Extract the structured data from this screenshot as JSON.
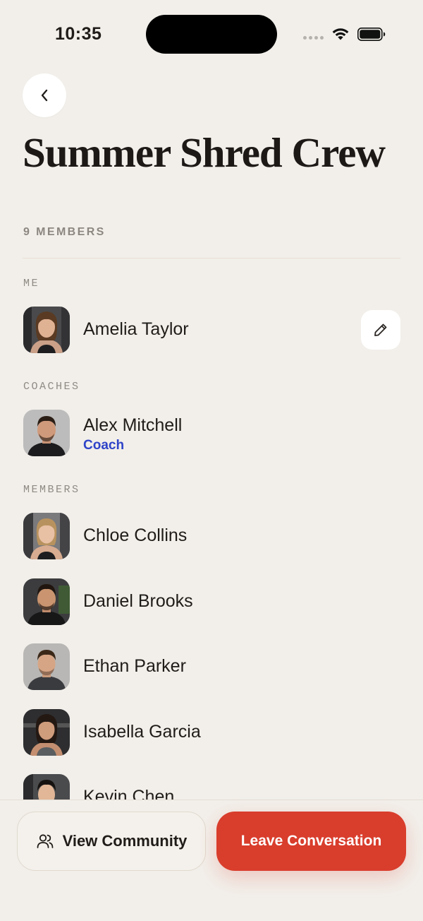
{
  "status_bar": {
    "time": "10:35"
  },
  "header": {
    "title": "Summer Shred Crew",
    "member_count": "9 MEMBERS"
  },
  "sections": {
    "me": {
      "label": "ME",
      "members": [
        {
          "name": "Amelia Taylor"
        }
      ]
    },
    "coaches": {
      "label": "COACHES",
      "members": [
        {
          "name": "Alex Mitchell",
          "role": "Coach"
        }
      ]
    },
    "members": {
      "label": "MEMBERS",
      "members": [
        {
          "name": "Chloe Collins"
        },
        {
          "name": "Daniel Brooks"
        },
        {
          "name": "Ethan Parker"
        },
        {
          "name": "Isabella Garcia"
        },
        {
          "name": "Kevin Chen"
        }
      ]
    }
  },
  "footer": {
    "view_community_label": "View Community",
    "leave_label": "Leave Conversation"
  },
  "colors": {
    "background": "#f2efea",
    "accent_red": "#d93d2c",
    "coach_blue": "#2f44c8"
  },
  "icons": [
    "back-chevron-icon",
    "pencil-icon",
    "people-icon",
    "wifi-icon",
    "battery-icon"
  ]
}
